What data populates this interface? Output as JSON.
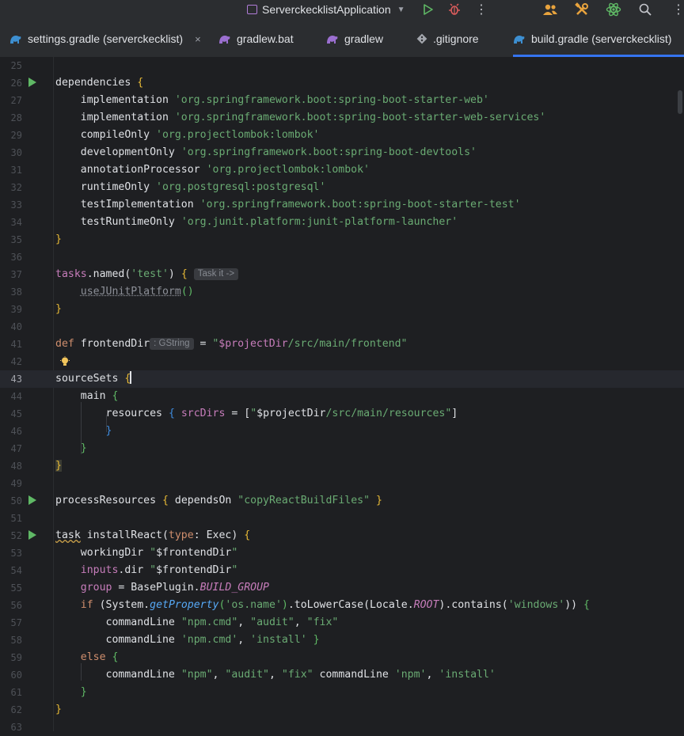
{
  "toolbar": {
    "run_config": "ServerckecklistApplication",
    "icons": [
      "run-icon",
      "debug-icon",
      "more-icon",
      "collab-icon",
      "build-tools-icon",
      "atom-icon",
      "search-icon",
      "settings-icon"
    ],
    "colors": {
      "run": "#5fb865",
      "debug": "#e05d5d",
      "accent": "#e8a33d"
    }
  },
  "tabs": [
    {
      "label": "settings.gradle (serverckecklist)",
      "icon": "gradle-icon",
      "closable": true,
      "active": false
    },
    {
      "label": "gradlew.bat",
      "icon": "gradle-icon",
      "closable": false,
      "active": false
    },
    {
      "label": "gradlew",
      "icon": "gradle-icon",
      "closable": false,
      "active": false
    },
    {
      "label": ".gitignore",
      "icon": "git-icon",
      "closable": false,
      "active": false
    },
    {
      "label": "build.gradle (serverckecklist)",
      "icon": "gradle-icon",
      "closable": false,
      "active": true
    }
  ],
  "tab_close_glyph": "×",
  "editor": {
    "current_line": 43,
    "run_markers": [
      26,
      50,
      52
    ],
    "hints": {
      "task_it": "Task it ->",
      "gstring": ": GString"
    },
    "lines": [
      {
        "n": 25,
        "text": ""
      },
      {
        "n": 26,
        "text": "dependencies {"
      },
      {
        "n": 27,
        "text": "    implementation 'org.springframework.boot:spring-boot-starter-web'"
      },
      {
        "n": 28,
        "text": "    implementation 'org.springframework.boot:spring-boot-starter-web-services'"
      },
      {
        "n": 29,
        "text": "    compileOnly 'org.projectlombok:lombok'"
      },
      {
        "n": 30,
        "text": "    developmentOnly 'org.springframework.boot:spring-boot-devtools'"
      },
      {
        "n": 31,
        "text": "    annotationProcessor 'org.projectlombok:lombok'"
      },
      {
        "n": 32,
        "text": "    runtimeOnly 'org.postgresql:postgresql'"
      },
      {
        "n": 33,
        "text": "    testImplementation 'org.springframework.boot:spring-boot-starter-test'"
      },
      {
        "n": 34,
        "text": "    testRuntimeOnly 'org.junit.platform:junit-platform-launcher'"
      },
      {
        "n": 35,
        "text": "}"
      },
      {
        "n": 36,
        "text": ""
      },
      {
        "n": 37,
        "text": "tasks.named('test') {"
      },
      {
        "n": 38,
        "text": "    useJUnitPlatform()"
      },
      {
        "n": 39,
        "text": "}"
      },
      {
        "n": 40,
        "text": ""
      },
      {
        "n": 41,
        "text": "def frontendDir = \"$projectDir/src/main/frontend\""
      },
      {
        "n": 42,
        "text": ""
      },
      {
        "n": 43,
        "text": "sourceSets {"
      },
      {
        "n": 44,
        "text": "    main {"
      },
      {
        "n": 45,
        "text": "        resources { srcDirs = [\"$projectDir/src/main/resources\"]"
      },
      {
        "n": 46,
        "text": "        }"
      },
      {
        "n": 47,
        "text": "    }"
      },
      {
        "n": 48,
        "text": "}"
      },
      {
        "n": 49,
        "text": ""
      },
      {
        "n": 50,
        "text": "processResources { dependsOn \"copyReactBuildFiles\" }"
      },
      {
        "n": 51,
        "text": ""
      },
      {
        "n": 52,
        "text": "task installReact(type: Exec) {"
      },
      {
        "n": 53,
        "text": "    workingDir \"$frontendDir\""
      },
      {
        "n": 54,
        "text": "    inputs.dir \"$frontendDir\""
      },
      {
        "n": 55,
        "text": "    group = BasePlugin.BUILD_GROUP"
      },
      {
        "n": 56,
        "text": "    if (System.getProperty('os.name').toLowerCase(Locale.ROOT).contains('windows')) {"
      },
      {
        "n": 57,
        "text": "        commandLine \"npm.cmd\", \"audit\", \"fix\""
      },
      {
        "n": 58,
        "text": "        commandLine 'npm.cmd', 'install' }"
      },
      {
        "n": 59,
        "text": "    else {"
      },
      {
        "n": 60,
        "text": "        commandLine \"npm\", \"audit\", \"fix\" commandLine 'npm', 'install'"
      },
      {
        "n": 61,
        "text": "    }"
      },
      {
        "n": 62,
        "text": "}"
      },
      {
        "n": 63,
        "text": ""
      }
    ]
  }
}
